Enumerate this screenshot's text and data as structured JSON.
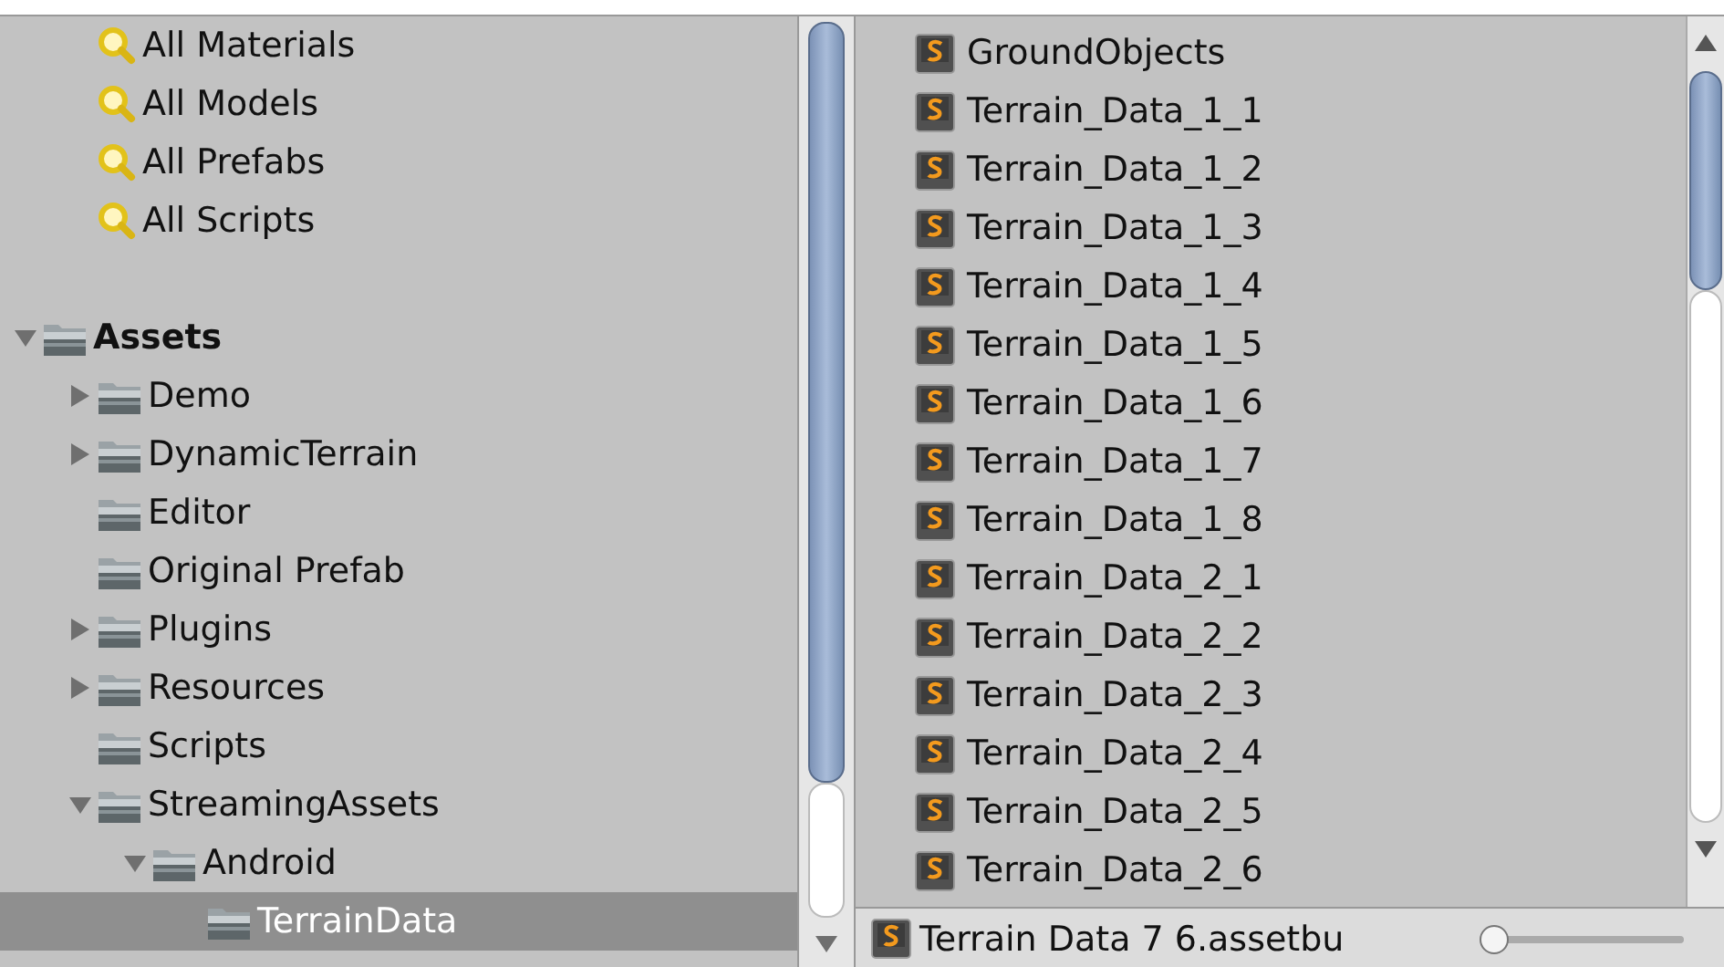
{
  "project_panel": {
    "favorites": [
      {
        "label": "All Materials"
      },
      {
        "label": "All Models"
      },
      {
        "label": "All Prefabs"
      },
      {
        "label": "All Scripts"
      }
    ],
    "folders": [
      {
        "label": "Assets",
        "expanded": true,
        "selected": false,
        "children": [
          {
            "label": "Demo",
            "expanded": false,
            "selected": false
          },
          {
            "label": "DynamicTerrain",
            "expanded": false,
            "selected": false
          },
          {
            "label": "Editor",
            "selected": false
          },
          {
            "label": "Original Prefab",
            "selected": false
          },
          {
            "label": "Plugins",
            "expanded": false,
            "selected": false
          },
          {
            "label": "Resources",
            "expanded": false,
            "selected": false
          },
          {
            "label": "Scripts",
            "selected": false
          },
          {
            "label": "StreamingAssets",
            "expanded": true,
            "selected": false,
            "children": [
              {
                "label": "Android",
                "expanded": true,
                "selected": false,
                "children": [
                  {
                    "label": "TerrainData",
                    "selected": true
                  }
                ]
              }
            ]
          }
        ]
      }
    ]
  },
  "asset_list": {
    "items": [
      {
        "label": "GroundObjects"
      },
      {
        "label": "Terrain_Data_1_1"
      },
      {
        "label": "Terrain_Data_1_2"
      },
      {
        "label": "Terrain_Data_1_3"
      },
      {
        "label": "Terrain_Data_1_4"
      },
      {
        "label": "Terrain_Data_1_5"
      },
      {
        "label": "Terrain_Data_1_6"
      },
      {
        "label": "Terrain_Data_1_7"
      },
      {
        "label": "Terrain_Data_1_8"
      },
      {
        "label": "Terrain_Data_2_1"
      },
      {
        "label": "Terrain_Data_2_2"
      },
      {
        "label": "Terrain_Data_2_3"
      },
      {
        "label": "Terrain_Data_2_4"
      },
      {
        "label": "Terrain_Data_2_5"
      },
      {
        "label": "Terrain_Data_2_6"
      }
    ],
    "footer": {
      "selected_name": "Terrain Data 7 6.assetbu",
      "zoom_slider": {
        "level": 0
      }
    }
  }
}
